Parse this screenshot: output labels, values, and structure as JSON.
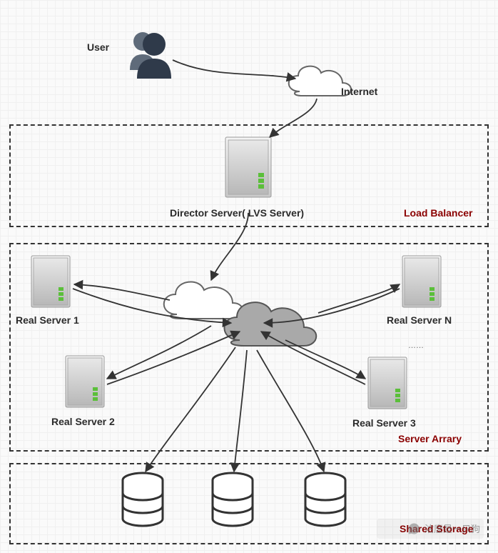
{
  "labels": {
    "user": "User",
    "internet": "Internet",
    "director": "Director Server( LVS Server)",
    "load_balancer": "Load Balancer",
    "real_server_1": "Real Server 1",
    "real_server_2": "Real Server 2",
    "real_server_3": "Real Server 3",
    "real_server_n": "Real Server N",
    "ellipsis": "……",
    "server_array": "Server Arrary",
    "shared_storage": "Shared Storage",
    "watermark": "沽麽是一只狗"
  }
}
